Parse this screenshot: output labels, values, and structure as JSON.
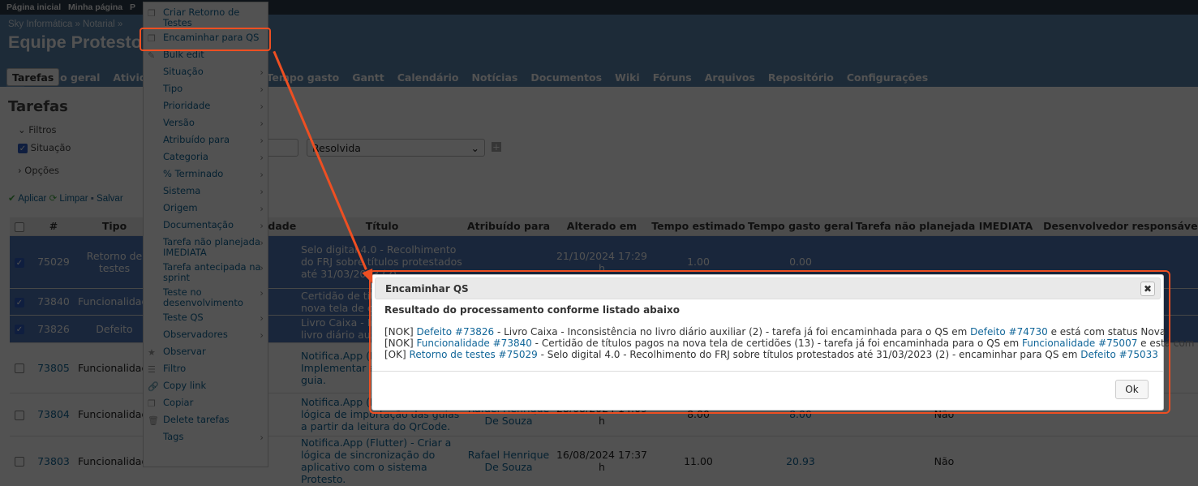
{
  "topbar": {
    "items": [
      "Página inicial",
      "Minha página",
      "P"
    ]
  },
  "header": {
    "breadcrumb": "Sky Informática » Notarial »",
    "title": "Equipe Protesto",
    "tabs": [
      "+",
      "Visão geral",
      "Atividade",
      "",
      "",
      "Tarefas",
      "Tempo gasto",
      "Gantt",
      "Calendário",
      "Notícias",
      "Documentos",
      "Wiki",
      "Fóruns",
      "Arquivos",
      "Repositório",
      "Configurações"
    ],
    "selected_tab": "Tarefas"
  },
  "main": {
    "title": "Tarefas",
    "filters_label": "Filtros",
    "filter_status_label": "Situação",
    "filter_value": "Resolvida",
    "options_label": "Opções",
    "actions": {
      "apply": "Aplicar",
      "clear": "Limpar",
      "save": "Salvar"
    }
  },
  "table": {
    "columns": [
      "#",
      "Tipo",
      "",
      "Prioridade",
      "Título",
      "Atribuído para",
      "Alterado em",
      "Tempo estimado",
      "Tempo gasto geral",
      "Tarefa não planejada IMEDIATA",
      "Desenvolvedor responsável"
    ],
    "rows": [
      {
        "selected": true,
        "id": "75029",
        "type": "Retorno de testes",
        "title": "Selo digital 4.0 - Recolhimento do FRJ sobre títulos protestados até 31/03/2023 (2)",
        "assigned": "",
        "updated": "21/10/2024 17:29 h",
        "est": "1.00",
        "spent": "0.00",
        "unplanned": ""
      },
      {
        "selected": true,
        "id": "73840",
        "type": "Funcionalidade",
        "title": "Certidão de títulos pagos na nova tela de certidões",
        "assigned": "",
        "updated": "",
        "est": "",
        "spent": "",
        "unplanned": ""
      },
      {
        "selected": true,
        "id": "73826",
        "type": "Defeito",
        "title": "Livro Caixa - Inconsistência no livro diário auxiliar",
        "assigned": "",
        "updated": "",
        "est": "",
        "spent": "",
        "unplanned": ""
      },
      {
        "selected": false,
        "id": "73805",
        "type": "Funcionalidade",
        "title": "Notifica.App (Flutter) - Implementar a visualização dos guia.",
        "assigned": "",
        "updated": "",
        "est": "",
        "spent": "",
        "unplanned": ""
      },
      {
        "selected": false,
        "id": "73804",
        "type": "Funcionalidade",
        "title": "Notifica.App (Flutter) - Criar a lógica de importação das guias a partir da leitura do QrCode.",
        "assigned": "Rafael Henrique De Souza",
        "updated": "28/08/2024 14:09 h",
        "est": "8.00",
        "spent": "8.00",
        "unplanned": "Não"
      },
      {
        "selected": false,
        "id": "73803",
        "type": "Funcionalidade",
        "title": "Notifica.App (Flutter) - Criar a lógica de sincronização do aplicativo com o sistema Protesto.",
        "assigned": "Rafael Henrique De Souza",
        "updated": "16/08/2024 17:37 h",
        "est": "11.00",
        "spent": "20.93",
        "unplanned": "Não"
      }
    ]
  },
  "context_menu": {
    "items": [
      {
        "label": "Criar Retorno de Testes",
        "icon": "copy-icon",
        "sub": false
      },
      {
        "label": "Encaminhar para QS",
        "icon": "copy-icon",
        "sub": false,
        "highlighted": true
      },
      {
        "label": "Bulk edit",
        "icon": "pencil-icon",
        "sub": false
      },
      {
        "label": "Situação",
        "sub": true
      },
      {
        "label": "Tipo",
        "sub": true
      },
      {
        "label": "Prioridade",
        "sub": true
      },
      {
        "label": "Versão",
        "sub": true
      },
      {
        "label": "Atribuído para",
        "sub": true
      },
      {
        "label": "Categoria",
        "sub": true
      },
      {
        "label": "% Terminado",
        "sub": true
      },
      {
        "label": "Sistema",
        "sub": true
      },
      {
        "label": "Origem",
        "sub": true
      },
      {
        "label": "Documentação",
        "sub": true
      },
      {
        "label": "Tarefa não planejada IMEDIATA",
        "sub": true
      },
      {
        "label": "Tarefa antecipada na sprint",
        "sub": true
      },
      {
        "label": "Teste no desenvolvimento",
        "sub": true
      },
      {
        "label": "Teste QS",
        "sub": true
      },
      {
        "label": "Observadores",
        "sub": true
      },
      {
        "label": "Observar",
        "icon": "star-icon",
        "sub": false
      },
      {
        "label": "Filtro",
        "icon": "list-icon",
        "sub": false
      },
      {
        "label": "Copy link",
        "icon": "link-icon",
        "sub": false
      },
      {
        "label": "Copiar",
        "icon": "copy-icon",
        "sub": false
      },
      {
        "label": "Delete tarefas",
        "icon": "trash-icon",
        "sub": false
      },
      {
        "label": "Tags",
        "sub": true
      }
    ]
  },
  "dialog": {
    "title": "Encaminhar QS",
    "close": "✖",
    "subtitle": "Resultado do processamento conforme listado abaixo",
    "lines": [
      {
        "status": "[NOK]",
        "link": "Defeito #73826",
        "text": " - Livro Caixa - Inconsistência no livro diário auxiliar (2) - tarefa já foi encaminhada para o QS em ",
        "link2": "Defeito #74730",
        "tail": " e está com status Nova"
      },
      {
        "status": "[NOK]",
        "link": "Funcionalidade #73840",
        "text": " - Certidão de títulos pagos na nova tela de certidões (13) - tarefa já foi encaminhada para o QS em ",
        "link2": "Funcionalidade #75007",
        "tail": " e está com status Nova"
      },
      {
        "status": "[OK]",
        "link": "Retorno de testes #75029",
        "text": " - Selo digital 4.0 - Recolhimento do FRJ sobre títulos protestados até 31/03/2023 (2) - encaminhar para QS em ",
        "link2": "Defeito #75033",
        "tail": ""
      }
    ],
    "ok": "Ok"
  },
  "colors": {
    "annotation": "#ee4f22",
    "link": "#116699",
    "header": "#5b87b0"
  }
}
